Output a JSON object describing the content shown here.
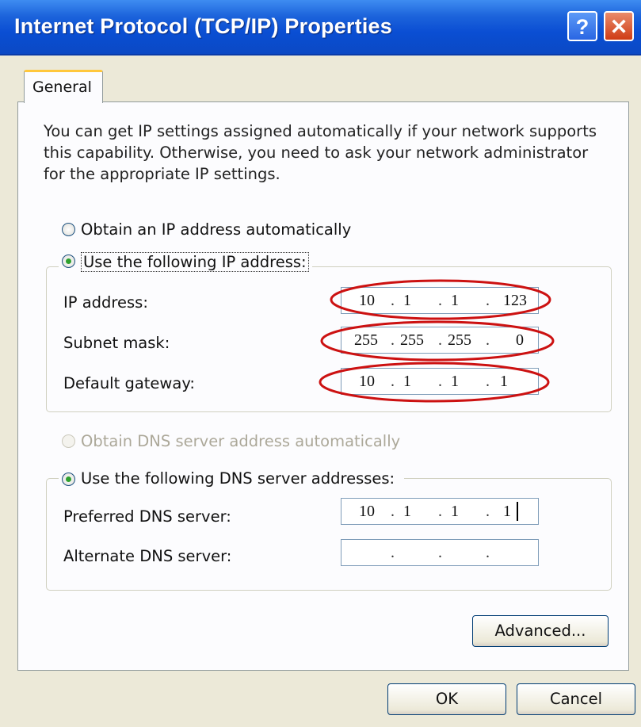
{
  "window": {
    "title": "Internet Protocol (TCP/IP) Properties",
    "help_glyph": "?",
    "close_glyph": "✕"
  },
  "tabs": [
    {
      "label": "General",
      "active": true
    }
  ],
  "description": "You can get IP settings assigned automatically if your network supports this capability. Otherwise, you need to ask your network administrator for the appropriate IP settings.",
  "ip_section": {
    "obtain_auto_label": "Obtain an IP address automatically",
    "use_following_label": "Use the following IP address:",
    "selected": "use_following",
    "fields": [
      {
        "label": "IP address:",
        "octets": [
          "10",
          "1",
          "1",
          "123"
        ]
      },
      {
        "label": "Subnet mask:",
        "octets": [
          "255",
          "255",
          "255",
          "0"
        ]
      },
      {
        "label": "Default gateway:",
        "octets": [
          "10",
          "1",
          "1",
          "1"
        ]
      }
    ]
  },
  "dns_section": {
    "obtain_auto_label": "Obtain DNS server address automatically",
    "obtain_auto_enabled": false,
    "use_following_label": "Use the following DNS server addresses:",
    "selected": "use_following",
    "fields": [
      {
        "label": "Preferred DNS server:",
        "octets": [
          "10",
          "1",
          "1",
          "1"
        ]
      },
      {
        "label": "Alternate DNS server:",
        "octets": [
          "",
          "",
          "",
          ""
        ]
      }
    ]
  },
  "buttons": {
    "advanced": "Advanced...",
    "ok": "OK",
    "cancel": "Cancel"
  },
  "colors": {
    "titlebar": "#0a4ed3",
    "dialog_bg": "#ece9d8",
    "annotation": "#cc1111",
    "radio_selected": "#2fa12f"
  }
}
